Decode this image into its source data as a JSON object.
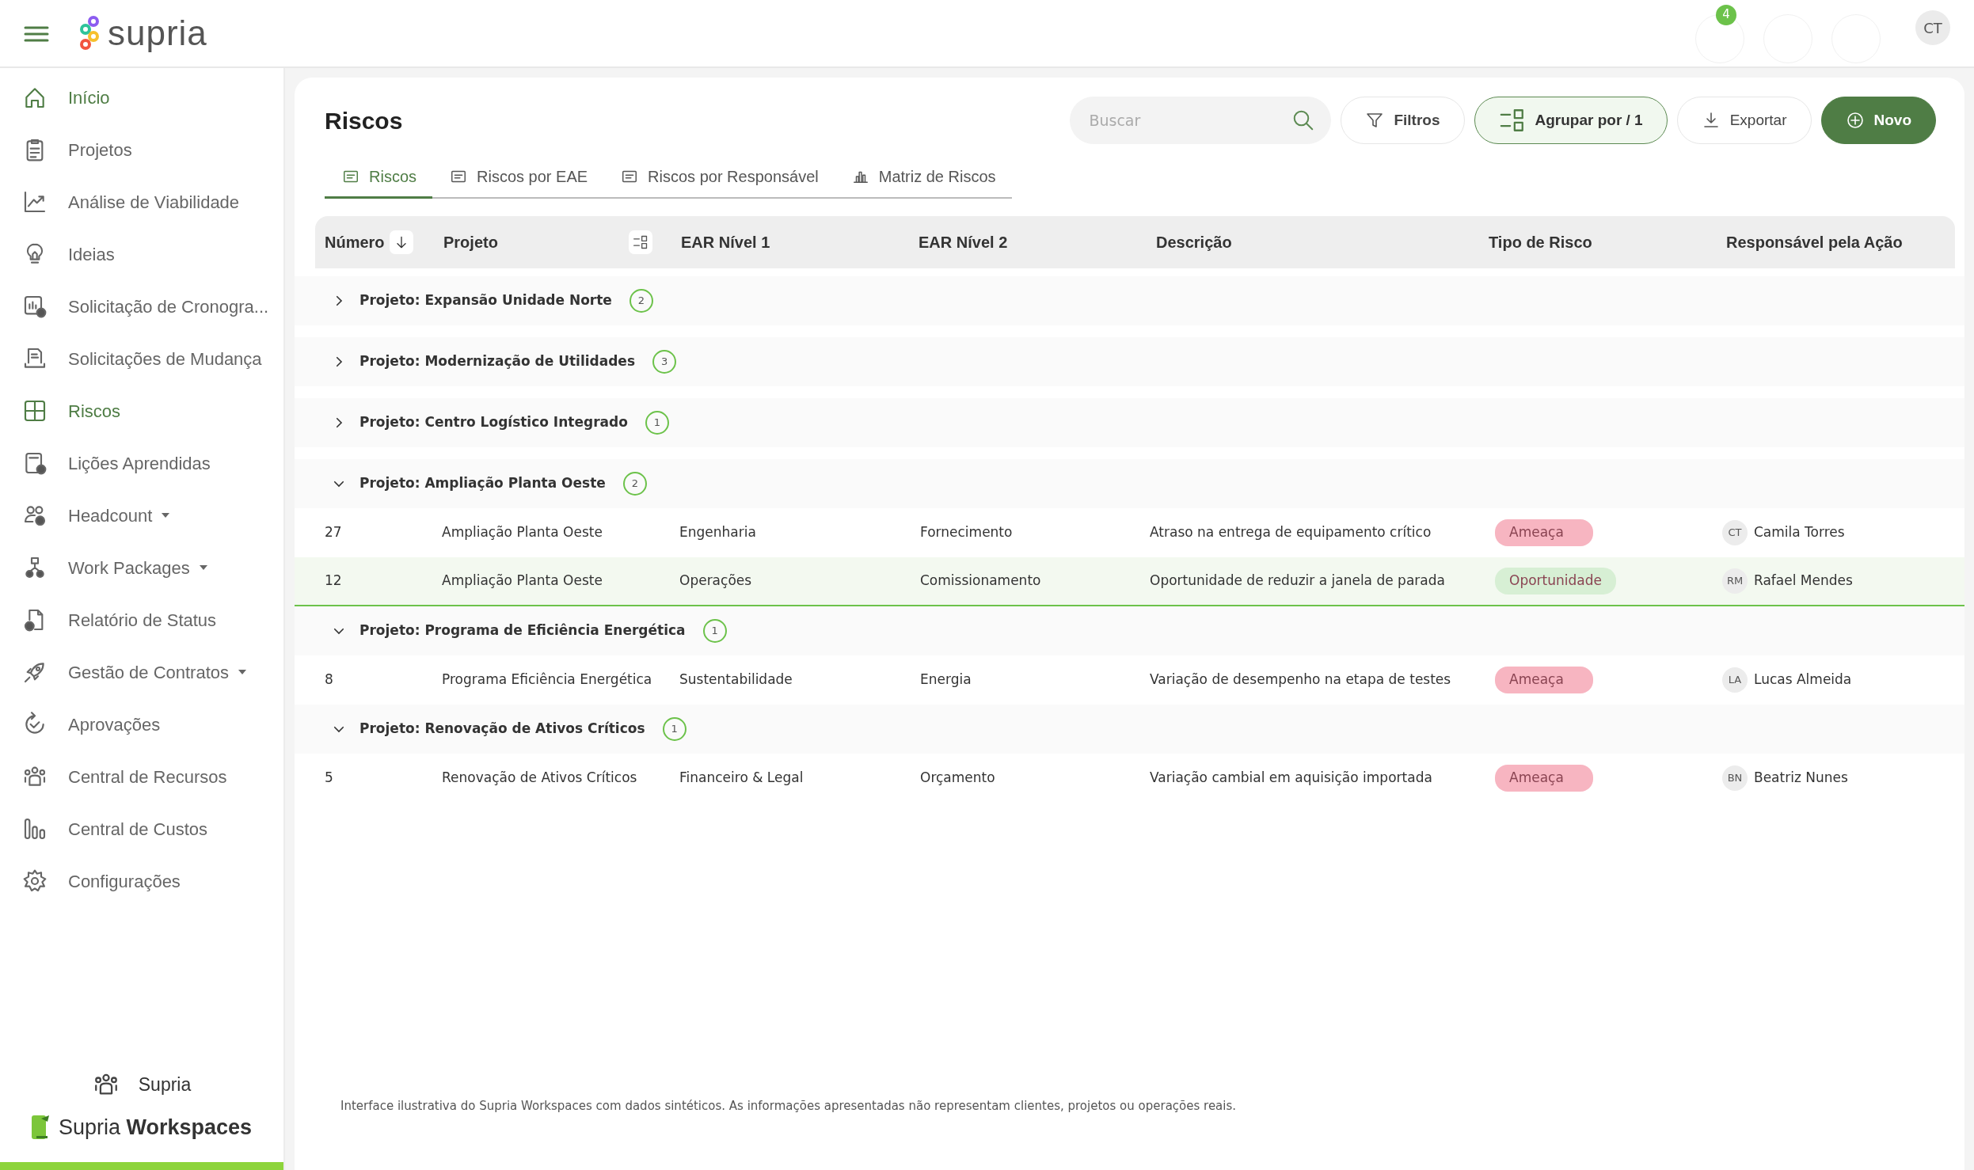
{
  "header": {
    "logo_text": "supria",
    "notification_count": "4",
    "avatar": "CT"
  },
  "sidebar": {
    "items": [
      {
        "label": "Início",
        "active": true,
        "dropdown": false
      },
      {
        "label": "Projetos",
        "active": false,
        "dropdown": false
      },
      {
        "label": "Análise de Viabilidade",
        "active": false,
        "dropdown": false
      },
      {
        "label": "Ideias",
        "active": false,
        "dropdown": false
      },
      {
        "label": "Solicitação de Cronogra...",
        "active": false,
        "dropdown": false
      },
      {
        "label": "Solicitações de Mudança",
        "active": false,
        "dropdown": false
      },
      {
        "label": "Riscos",
        "active": true,
        "dropdown": false
      },
      {
        "label": "Lições Aprendidas",
        "active": false,
        "dropdown": false
      },
      {
        "label": "Headcount",
        "active": false,
        "dropdown": true
      },
      {
        "label": "Work Packages",
        "active": false,
        "dropdown": true
      },
      {
        "label": "Relatório de Status",
        "active": false,
        "dropdown": false
      },
      {
        "label": "Gestão de Contratos",
        "active": false,
        "dropdown": true
      },
      {
        "label": "Aprovações",
        "active": false,
        "dropdown": false
      },
      {
        "label": "Central de Recursos",
        "active": false,
        "dropdown": false
      },
      {
        "label": "Central de Custos",
        "active": false,
        "dropdown": false
      },
      {
        "label": "Configurações",
        "active": false,
        "dropdown": false
      }
    ],
    "workspace": "Supria",
    "brand": "Supria **Workspaces**"
  },
  "page": {
    "title": "Riscos",
    "search": {
      "placeholder": "Buscar"
    },
    "buttons": [
      {
        "label": "Filtros",
        "kind": "filter"
      },
      {
        "label": "Agrupar por / 1",
        "kind": "group"
      },
      {
        "label": "Exportar",
        "kind": "export"
      },
      {
        "label": "Novo",
        "kind": "new"
      }
    ],
    "tabs": [
      {
        "label": "Riscos",
        "selected": true,
        "kind": "folder"
      },
      {
        "label": "Riscos por EAE",
        "selected": false,
        "kind": "folder"
      },
      {
        "label": "Riscos por Responsável",
        "selected": false,
        "kind": "folder"
      },
      {
        "label": "Matriz de Riscos",
        "selected": false,
        "kind": "chart"
      }
    ]
  },
  "table": {
    "columns": [
      {
        "label": "Número",
        "sorted": true
      },
      {
        "label": "Projeto",
        "sorted": false
      },
      {
        "label": "EAR Nível 1",
        "sorted": false
      },
      {
        "label": "EAR Nível 2",
        "sorted": false
      },
      {
        "label": "Descrição",
        "sorted": false
      },
      {
        "label": "Tipo de Risco",
        "sorted": false
      },
      {
        "label": "Responsável pela Ação",
        "sorted": false
      }
    ],
    "groups": [
      {
        "label": "Projeto: Expansão Unidade Norte",
        "count": "2",
        "expanded": false
      },
      {
        "label": "Projeto: Modernização de Utilidades",
        "count": "3",
        "expanded": false
      },
      {
        "label": "Projeto: Centro Logístico Integrado",
        "count": "1",
        "expanded": false
      },
      {
        "label": "Projeto: Ampliação Planta Oeste",
        "count": "2",
        "expanded": true,
        "rows": [
          {
            "number": "27",
            "project": "Ampliação Planta Oeste",
            "ear1": "Engenharia",
            "ear2": "Fornecimento",
            "description": "Atraso na entrega de equipamento crítico",
            "type": "Ameaça",
            "color": "#f7b5c1",
            "initials": "CT",
            "owner": "Camila Torres",
            "selected": false
          },
          {
            "number": "12",
            "project": "Ampliação Planta Oeste",
            "ear1": "Operações",
            "ear2": "Comissionamento",
            "description": "Oportunidade de reduzir a janela de parada",
            "type": "Oportunidade",
            "color": "#d7efd4",
            "initials": "RM",
            "owner": "Rafael Mendes",
            "selected": true
          }
        ]
      },
      {
        "label": "Projeto: Programa de Eficiência Energética",
        "count": "1",
        "expanded": true,
        "rows": [
          {
            "number": "8",
            "project": "Programa Eficiência Energética",
            "ear1": "Sustentabilidade",
            "ear2": "Energia",
            "description": "Variação de desempenho na etapa de testes",
            "type": "Ameaça",
            "color": "#f7b5c1",
            "initials": "LA",
            "owner": "Lucas Almeida",
            "selected": false
          }
        ]
      },
      {
        "label": "Projeto: Renovação de Ativos Críticos",
        "count": "1",
        "expanded": true,
        "rows": [
          {
            "number": "5",
            "project": "Renovação de Ativos Críticos",
            "ear1": "Financeiro & Legal",
            "ear2": "Orçamento",
            "description": "Variação cambial em aquisição importada",
            "type": "Ameaça",
            "color": "#f7b5c1",
            "initials": "BN",
            "owner": "Beatriz Nunes",
            "selected": false
          }
        ]
      }
    ]
  },
  "footnote": "Interface ilustrativa do Supria Workspaces com dados sintéticos. As informações apresentadas não representam clientes, projetos ou operações reais."
}
